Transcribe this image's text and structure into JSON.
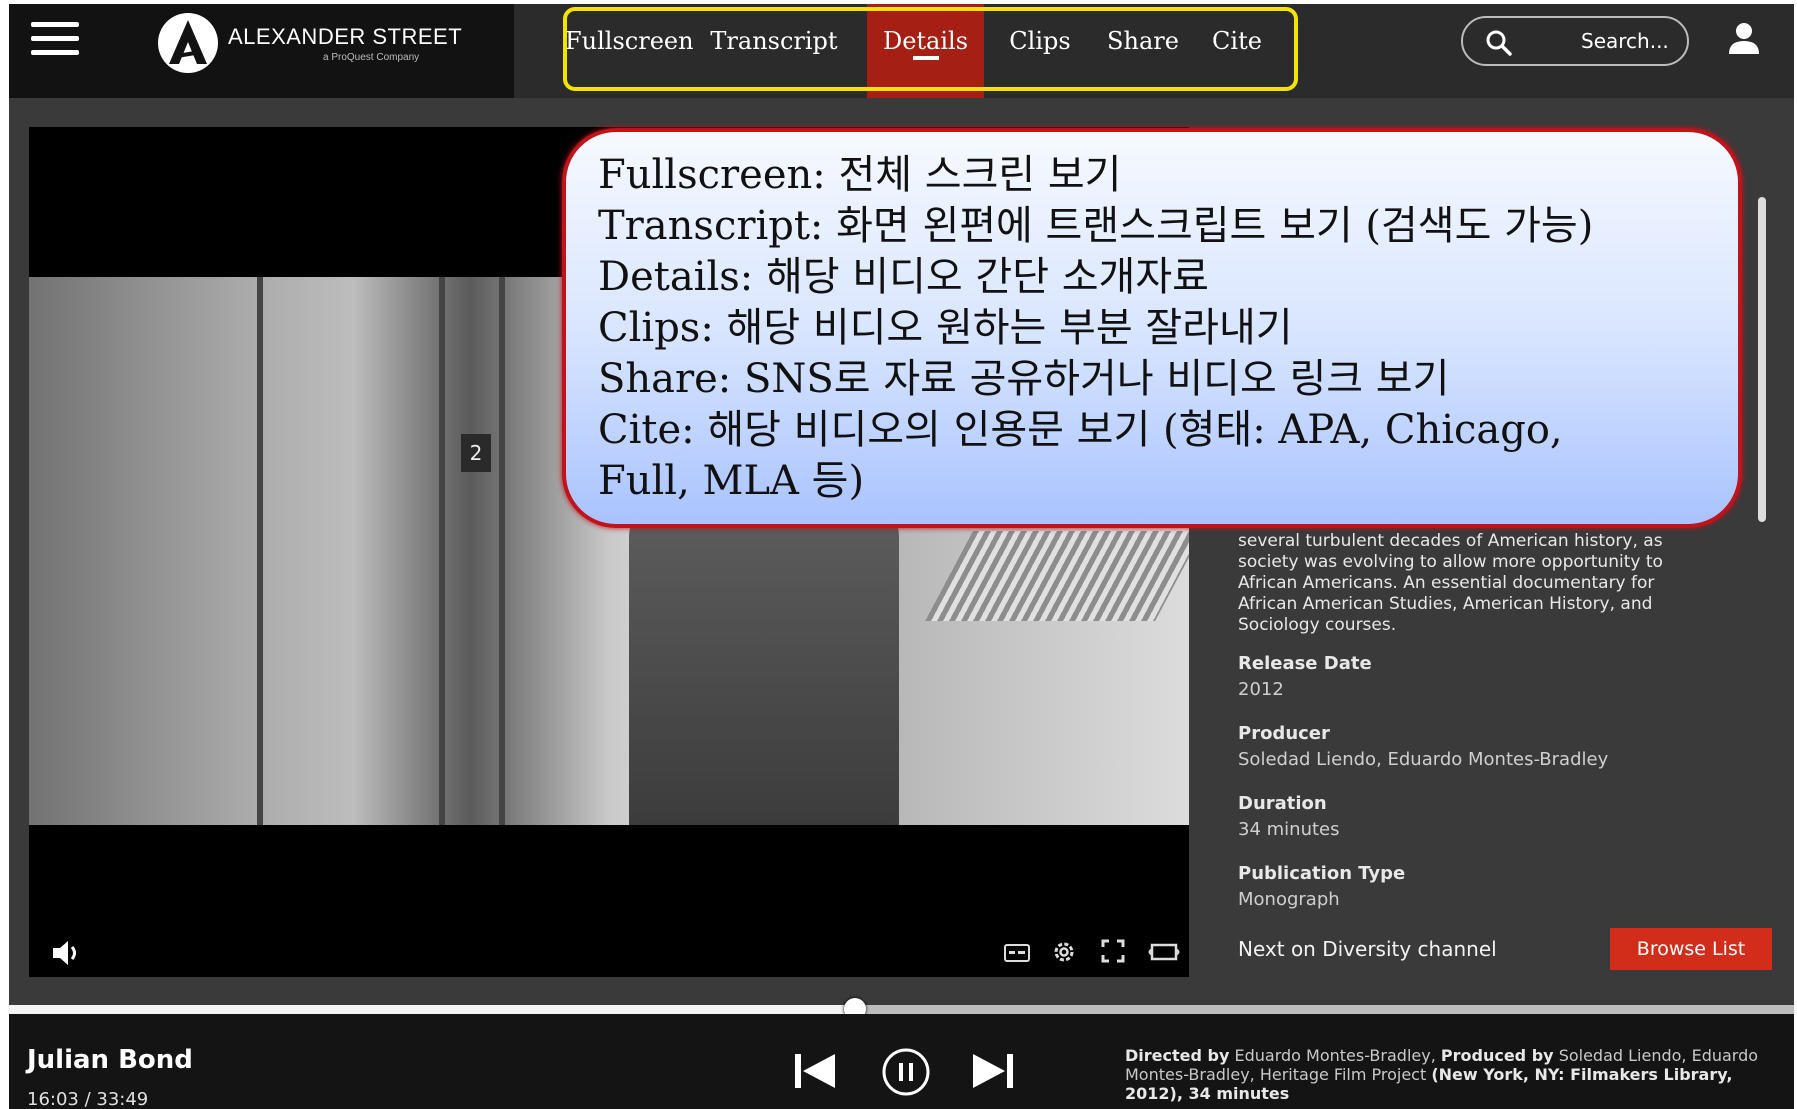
{
  "header": {
    "logo_text": "ALEXANDER STREET",
    "logo_sub": "a ProQuest Company",
    "tabs": [
      {
        "label": "Fullscreen"
      },
      {
        "label": "Transcript"
      },
      {
        "label": "Details"
      },
      {
        "label": "Clips"
      },
      {
        "label": "Share"
      },
      {
        "label": "Cite"
      }
    ],
    "active_tab": "Details",
    "search_placeholder": "Search..."
  },
  "video": {
    "frame_panel_number": "2"
  },
  "details": {
    "description": "several turbulent decades of American history, as society was evolving to allow more opportunity to African Americans. An essential documentary for African American Studies, American History, and Sociology courses.",
    "fields": [
      {
        "label": "Release Date",
        "value": "2012"
      },
      {
        "label": "Producer",
        "value": "Soledad Liendo, Eduardo Montes-Bradley"
      },
      {
        "label": "Duration",
        "value": "34 minutes"
      },
      {
        "label": "Publication Type",
        "value": "Monograph"
      }
    ],
    "next_text": "Next on Diversity channel",
    "browse_label": "Browse List"
  },
  "player": {
    "title": "Julian Bond",
    "time": "16:03 / 33:49",
    "progress": 0.474
  },
  "credits": {
    "directed_by_label": "Directed by",
    "director": "Eduardo Montes-Bradley,",
    "produced_by_label": "Produced by",
    "producers": "Soledad Liendo, Eduardo Montes-Bradley, Heritage Film Project",
    "publisher": "(New York, NY: Filmakers Library, 2012), 34 minutes"
  },
  "callout": {
    "lines": [
      "Fullscreen: 전체 스크린 보기",
      "Transcript: 화면 왼편에 트랜스크립트 보기 (검색도 가능)",
      "Details: 해당 비디오 간단 소개자료",
      "Clips: 해당 비디오 원하는 부분 잘라내기",
      "Share: SNS로 자료 공유하거나 비디오 링크 보기",
      "Cite: 해당 비디오의 인용문 보기 (형태: APA, Chicago,",
      "Full, MLA 등)"
    ]
  },
  "colors": {
    "active_tab": "#a51f14",
    "highlight_frame": "#f3e400",
    "callout_border": "#c0131c",
    "browse_button": "#d12d1a"
  }
}
